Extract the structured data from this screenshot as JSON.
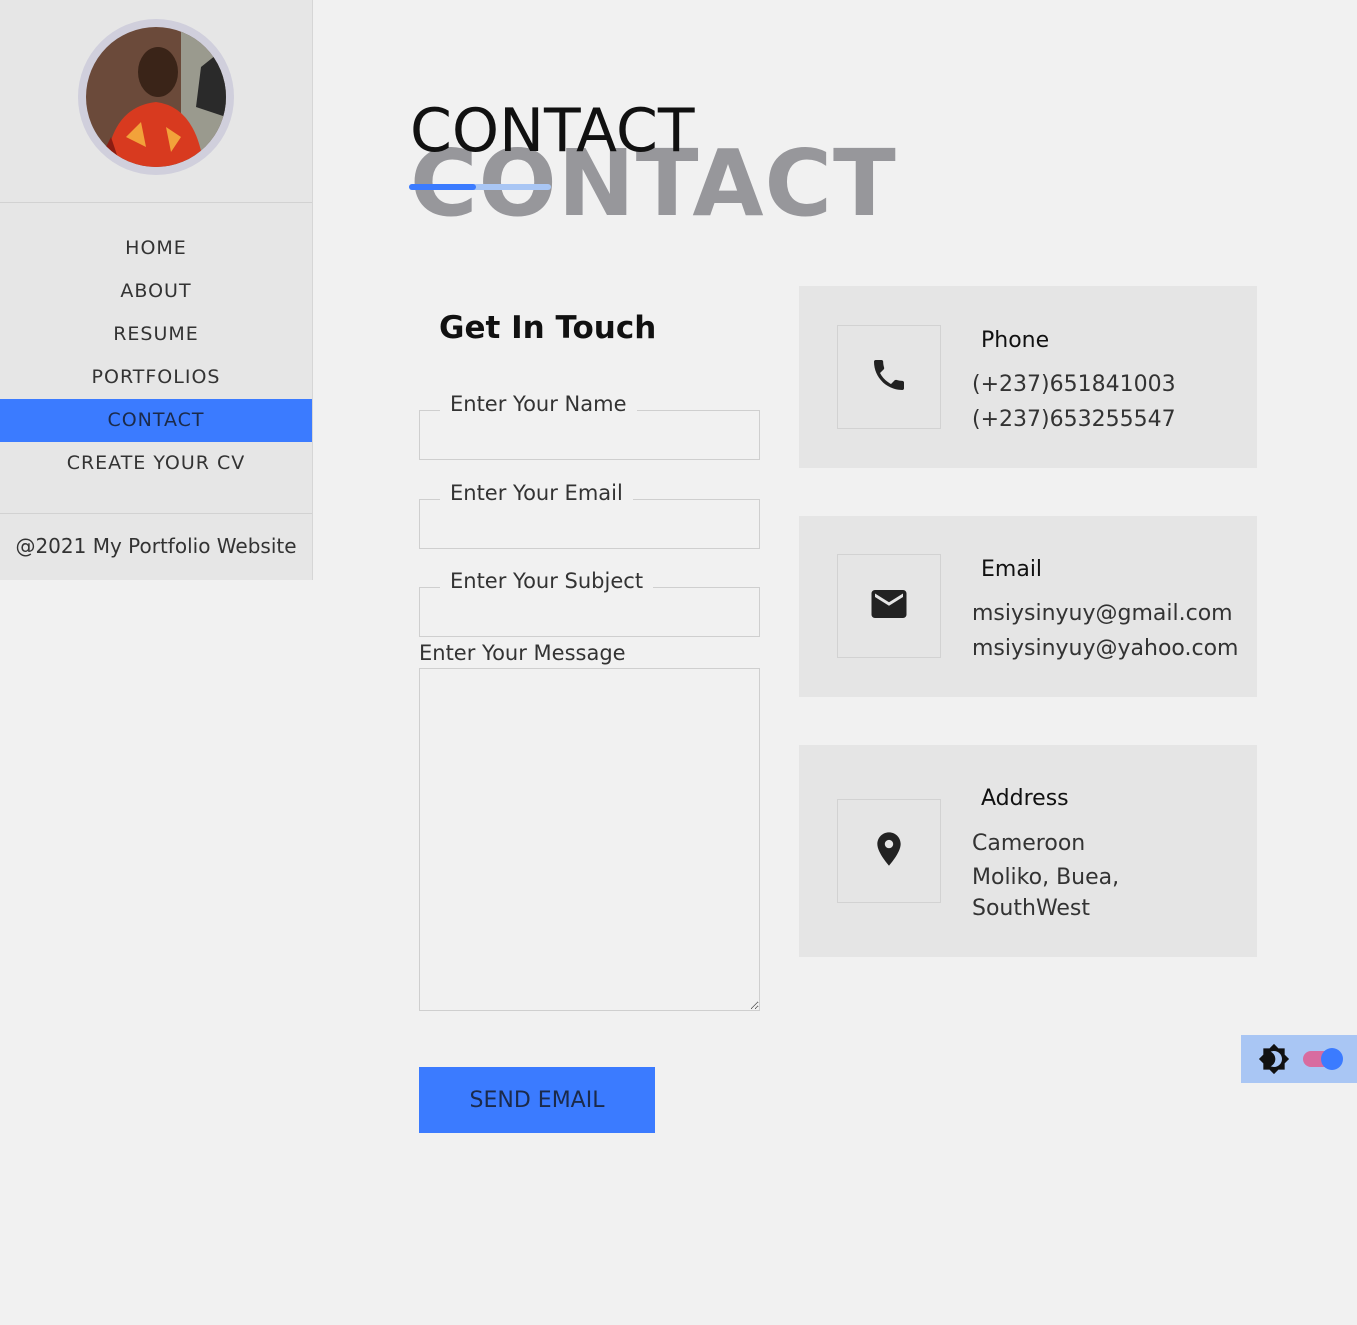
{
  "sidebar": {
    "avatar_alt": "Profile photo",
    "nav": [
      {
        "label": "HOME"
      },
      {
        "label": "ABOUT"
      },
      {
        "label": "RESUME"
      },
      {
        "label": "PORTFOLIOS"
      },
      {
        "label": "CONTACT",
        "active": true
      },
      {
        "label": "CREATE YOUR CV"
      }
    ],
    "footer": "@2021 My Portfolio Website"
  },
  "header": {
    "title": "CONTACT",
    "title_shadow": "CONTACT"
  },
  "form": {
    "heading": "Get In Touch",
    "name_label": "Enter Your Name",
    "email_label": "Enter Your Email",
    "subject_label": "Enter Your Subject",
    "message_label": "Enter Your Message",
    "send_label": "SEND EMAIL"
  },
  "contact": {
    "phone": {
      "title": "Phone",
      "icon": "phone-icon",
      "lines": [
        "(+237)651841003",
        "(+237)653255547"
      ]
    },
    "email": {
      "title": "Email",
      "icon": "envelope-icon",
      "lines": [
        "msiysinyuy@gmail.com",
        "msiysinyuy@yahoo.com"
      ]
    },
    "address": {
      "title": "Address",
      "icon": "map-pin-icon",
      "lines": [
        "Cameroon",
        "Moliko, Buea,",
        "SouthWest"
      ]
    }
  },
  "theme": {
    "icon": "brightness-icon",
    "accent": "#3b7bff",
    "toggle_on": true
  }
}
